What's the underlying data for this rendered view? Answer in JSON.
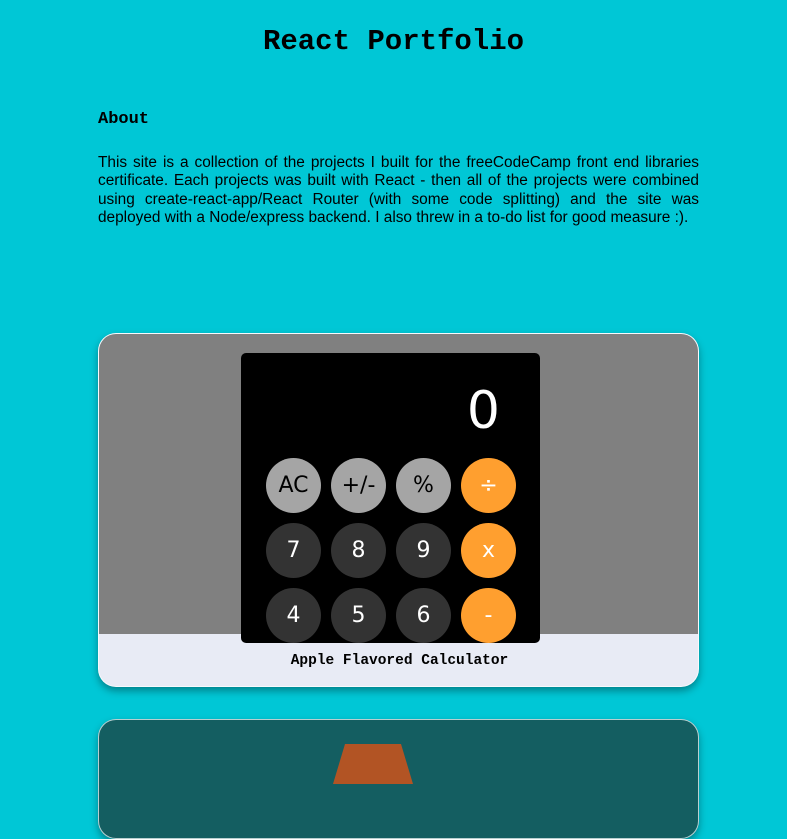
{
  "header": {
    "title": "React Portfolio"
  },
  "about": {
    "heading": "About",
    "text": "This site is a collection of the projects I built for the freeCodeCamp front end libraries certificate. Each projects was built with React - then all of the projects were combined using create-react-app/React Router (with some code splitting) and the site was deployed with a Node/express backend. I also threw in a to-do list for good measure :)."
  },
  "projects": [
    {
      "caption": "Apple Flavored Calculator",
      "preview": {
        "display": "0",
        "rows": [
          [
            {
              "label": "AC",
              "kind": "func"
            },
            {
              "label": "+/-",
              "kind": "func"
            },
            {
              "label": "%",
              "kind": "func"
            },
            {
              "label": "÷",
              "kind": "op"
            }
          ],
          [
            {
              "label": "7",
              "kind": "num"
            },
            {
              "label": "8",
              "kind": "num"
            },
            {
              "label": "9",
              "kind": "num"
            },
            {
              "label": "x",
              "kind": "op"
            }
          ],
          [
            {
              "label": "4",
              "kind": "num"
            },
            {
              "label": "5",
              "kind": "num"
            },
            {
              "label": "6",
              "kind": "num"
            },
            {
              "label": "-",
              "kind": "op"
            }
          ]
        ]
      }
    },
    {
      "caption": ""
    }
  ],
  "colors": {
    "background": "#00c7d6",
    "card_caption_bg": "#e8ebf5",
    "calc_operator": "#ff9f2f",
    "calc_function": "#a5a5a5",
    "calc_number": "#333333",
    "card2_bg": "#145e61",
    "card2_shape": "#b25424"
  }
}
